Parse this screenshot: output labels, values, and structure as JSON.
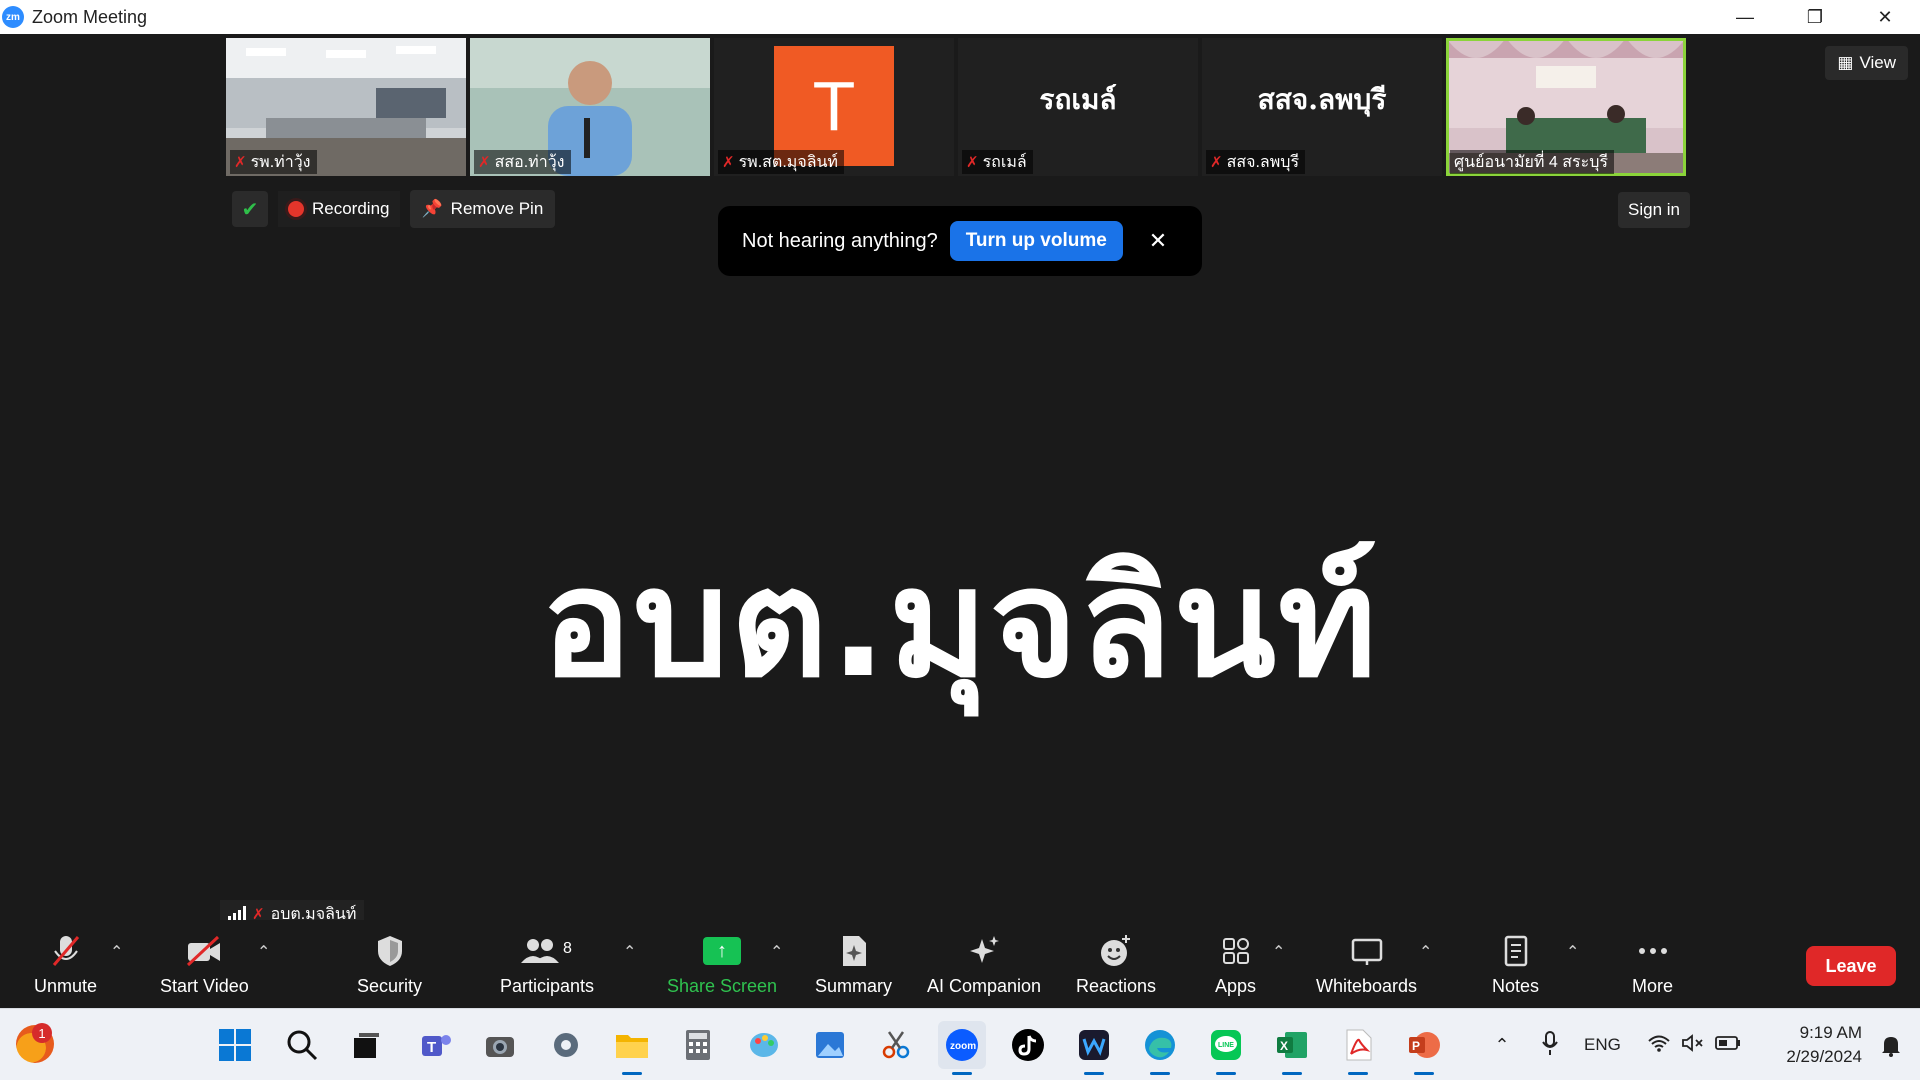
{
  "window": {
    "title": "Zoom Meeting",
    "logo_text": "zm"
  },
  "thumbnails": [
    {
      "name": "รพ.ท่าวุ้ง",
      "kind": "video",
      "active": false
    },
    {
      "name": "สสอ.ท่าวุ้ง",
      "kind": "video",
      "active": false
    },
    {
      "name": "รพ.สต.มุจลินท์",
      "kind": "avatar",
      "initial": "T",
      "active": false
    },
    {
      "name": "รถเมล์",
      "kind": "name",
      "big": "รถเมล์",
      "active": false
    },
    {
      "name": "สสจ.ลพบุรี",
      "kind": "name",
      "big": "สสจ.ลพบุรี",
      "active": false
    },
    {
      "name": "ศูนย์อนามัยที่ 4 สระบุรี",
      "kind": "video",
      "active": true
    }
  ],
  "view_button": "View",
  "status": {
    "recording_label": "Recording",
    "remove_pin_label": "Remove Pin"
  },
  "sign_in_label": "Sign in",
  "toast": {
    "message": "Not hearing anything?",
    "action": "Turn up volume"
  },
  "main_speaker": "อบต.มุจลินท์",
  "self_view": {
    "name": "อบต.มุจลินท์"
  },
  "toolbar": {
    "unmute": "Unmute",
    "start_video": "Start Video",
    "security": "Security",
    "participants": "Participants",
    "participants_count": "8",
    "share_screen": "Share Screen",
    "summary": "Summary",
    "ai_companion": "AI Companion",
    "reactions": "Reactions",
    "apps": "Apps",
    "whiteboards": "Whiteboards",
    "notes": "Notes",
    "more": "More",
    "leave": "Leave"
  },
  "taskbar": {
    "weather_badge": "1",
    "language": "ENG",
    "time": "9:19 AM",
    "date": "2/29/2024"
  },
  "colors": {
    "share_green": "#16c254",
    "leave_red": "#e02828",
    "turn_up_blue": "#1a73e8",
    "active_thumb_border": "#8bd43a",
    "avatar_orange": "#f05a24"
  }
}
